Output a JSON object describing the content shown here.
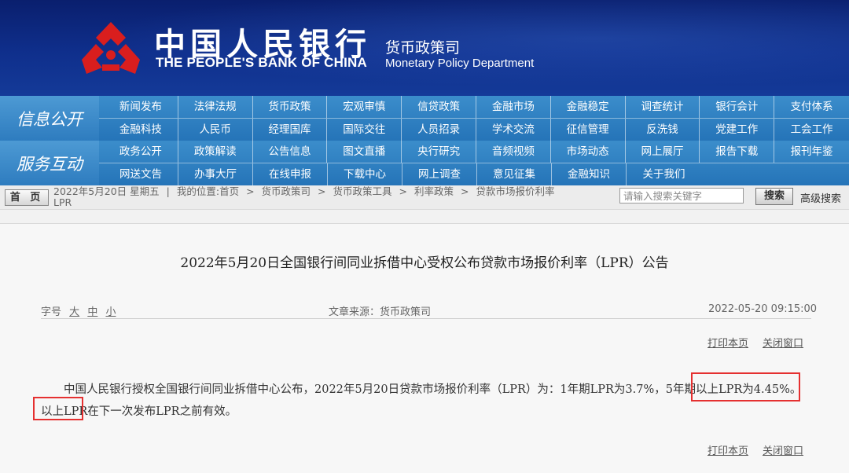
{
  "header": {
    "bank_name_cn": "中国人民银行",
    "bank_name_en": "THE PEOPLE'S BANK OF CHINA",
    "department_cn": "货币政策司",
    "department_en": "Monetary Policy Department",
    "emblem_color": "#d91e1e"
  },
  "nav": {
    "info_title": "信息公开",
    "info_row1": [
      "新闻发布",
      "法律法规",
      "货币政策",
      "宏观审慎",
      "信贷政策",
      "金融市场",
      "金融稳定",
      "调查统计",
      "银行会计",
      "支付体系"
    ],
    "info_row2": [
      "金融科技",
      "人民币",
      "经理国库",
      "国际交往",
      "人员招录",
      "学术交流",
      "征信管理",
      "反洗钱",
      "党建工作",
      "工会工作"
    ],
    "service_title": "服务互动",
    "service_row1": [
      "政务公开",
      "政策解读",
      "公告信息",
      "图文直播",
      "央行研究",
      "音频视频",
      "市场动态",
      "网上展厅",
      "报告下载",
      "报刊年鉴"
    ],
    "service_row2": [
      "网送文告",
      "办事大厅",
      "在线申报",
      "下载中心",
      "网上调查",
      "意见征集",
      "金融知识",
      "关于我们"
    ]
  },
  "crumb": {
    "home": "首 页",
    "date": "2022年5月20日",
    "weekday": "星期五",
    "location_label": "我的位置:首页",
    "path": [
      "货币政策司",
      "货币政策工具",
      "利率政策",
      "贷款市场报价利率",
      "LPR"
    ],
    "search_placeholder": "请输入搜索关键字",
    "search_button": "搜索",
    "advanced_search": "高级搜索"
  },
  "article": {
    "title": "2022年5月20日全国银行间同业拆借中心受权公布贷款市场报价利率（LPR）公告",
    "font_label": "字号",
    "font_large": "大",
    "font_medium": "中",
    "font_small": "小",
    "source": "文章来源：货币政策司",
    "datetime": "2022-05-20  09:15:00",
    "print": "打印本页",
    "close": "关闭窗口",
    "body_part1": "中国人民银行授权全国银行间同业拆借中心公布，2022年5月20日贷款市场报价利率（LPR）为：1年期LPR为3.7%，",
    "body_highlight": "5年期以上LPR为4.45%",
    "body_part2": "。以上LPR在下一次发布LPR之前有效。",
    "highlight_color": "#e53030"
  }
}
